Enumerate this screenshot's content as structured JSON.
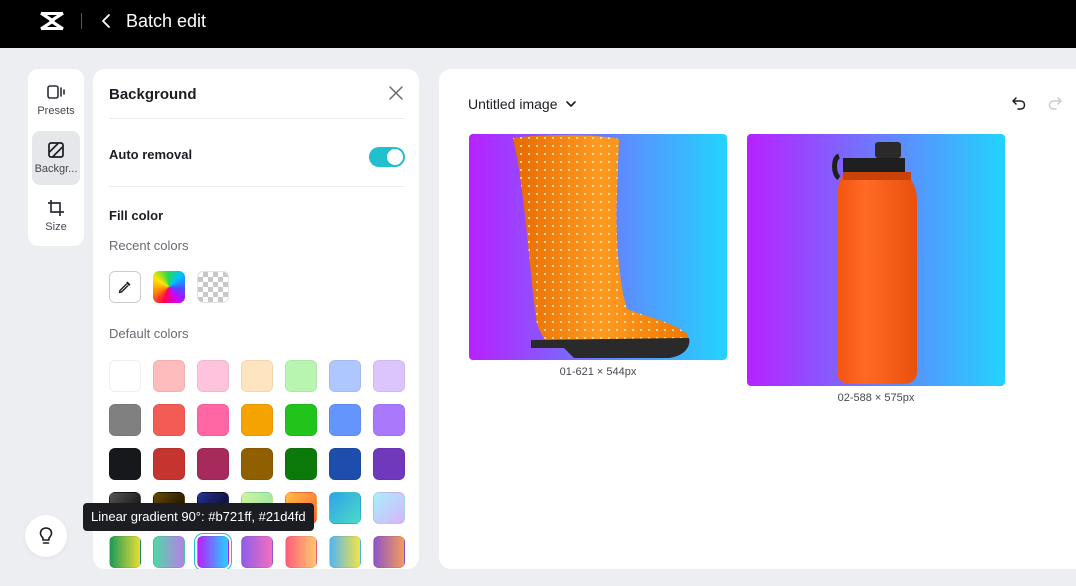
{
  "topbar": {
    "title": "Batch edit",
    "logo_icon": "capcut-logo-icon",
    "back_icon": "chevron-left-icon"
  },
  "rail": {
    "items": [
      {
        "label": "Presets",
        "icon": "presets-icon",
        "active": false
      },
      {
        "label": "Backgr...",
        "icon": "background-icon",
        "active": true
      },
      {
        "label": "Size",
        "icon": "crop-icon",
        "active": false
      }
    ]
  },
  "panel": {
    "title": "Background",
    "close_icon": "close-icon",
    "auto_removal": {
      "label": "Auto removal",
      "enabled": true
    },
    "fill_color": {
      "heading": "Fill color",
      "recent_label": "Recent colors",
      "recent": [
        "eyedropper-icon",
        "rainbow-picker",
        "transparent-swatch"
      ],
      "default_label": "Default colors",
      "default_colors": [
        [
          "#ffffff",
          "#ffbcbc",
          "#ffc3dd",
          "#ffe5bf",
          "#b8f5b0",
          "#aec8ff",
          "#dcc5fd"
        ],
        [
          "#808080",
          "#f25c54",
          "#ff66a3",
          "#f5a300",
          "#20c41a",
          "#6495fd",
          "#aa79fb"
        ],
        [
          "#17181c",
          "#c5342e",
          "#a62a5b",
          "#8f5f00",
          "#0b7a0b",
          "#1d4ead",
          "#7038bd"
        ],
        [
          "linear-gradient(135deg,#555,#000)",
          "linear-gradient(135deg,#6a4b00,#000)",
          "linear-gradient(135deg,#263399,#000)",
          "linear-gradient(135deg,#d3f59a,#82e0aa)",
          "linear-gradient(135deg,#ffc043,#ff5a36)",
          "linear-gradient(135deg,#2fa3e6,#4adbc8)",
          "linear-gradient(135deg,#a7f0fb,#d7b4fb)"
        ],
        [
          "linear-gradient(90deg,#1c9b5a,#e9dd33)",
          "linear-gradient(90deg,#4fd8a7,#ba7fe8)",
          "linear-gradient(90deg,#b721ff,#21d4fd)",
          "linear-gradient(90deg,#8f5de9,#f36ec0)",
          "linear-gradient(90deg,#ff5e79,#ffc96f)",
          "linear-gradient(90deg,#52b6f5,#f5e342)",
          "linear-gradient(90deg,#8c56c8,#f59c5a)"
        ]
      ],
      "selected": "linear-gradient(90deg,#b721ff,#21d4fd)"
    }
  },
  "tooltip": {
    "text": "Linear gradient 90°: #b721ff, #21d4fd"
  },
  "help": {
    "icon": "lightbulb-icon"
  },
  "canvas": {
    "doc_title": "Untitled image",
    "undo_icon": "undo-icon",
    "redo_icon": "redo-icon",
    "images": [
      {
        "caption": "01-621 × 544px",
        "subject": "orange polka-dot rain boot"
      },
      {
        "caption": "02-588 × 575px",
        "subject": "orange water bottle"
      }
    ]
  },
  "colors": {
    "accent": "#22bfcf",
    "gradient_start": "#b721ff",
    "gradient_end": "#21d4fd",
    "topbar_bg": "#000000",
    "page_bg": "#eceef1"
  }
}
